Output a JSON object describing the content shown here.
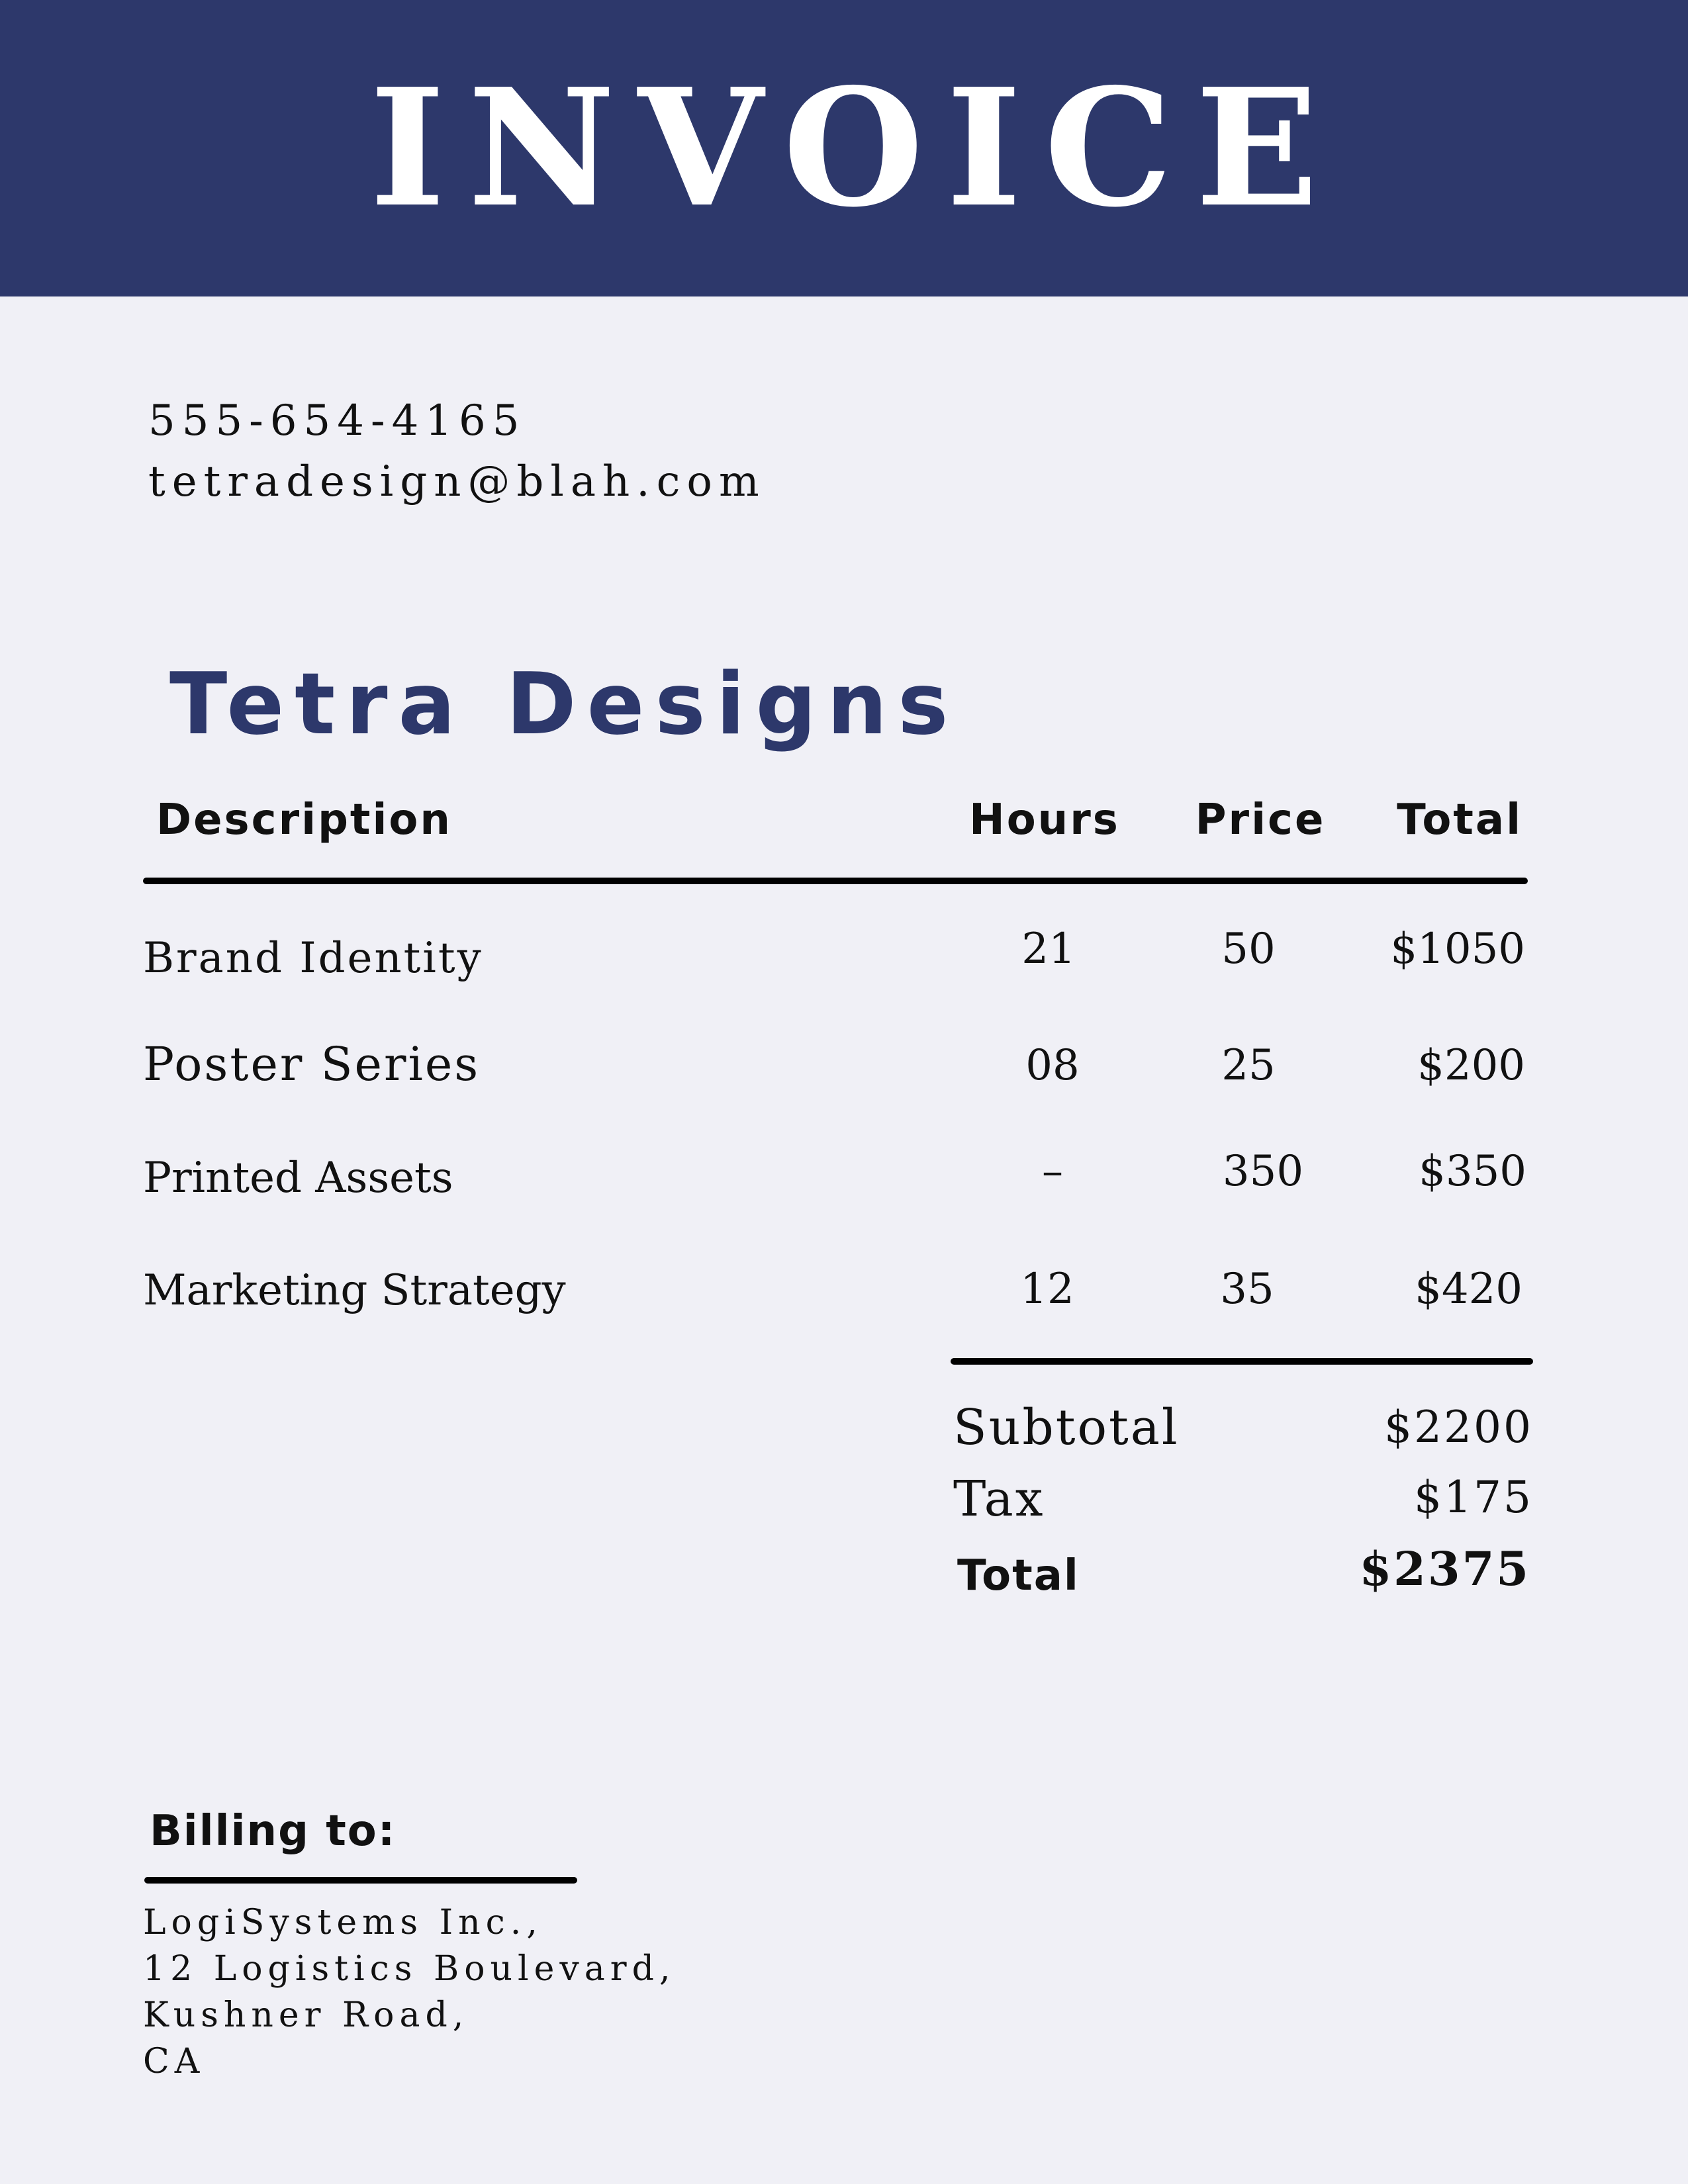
{
  "header": {
    "title": "INVOICE"
  },
  "contact": {
    "phone": "555-654-4165",
    "email": "tetradesign@blah.com"
  },
  "company": {
    "name": "Tetra Designs"
  },
  "table": {
    "columns": [
      "Description",
      "Hours",
      "Price",
      "Total"
    ],
    "rows": [
      {
        "description": "Brand Identity",
        "hours": "21",
        "price": "50",
        "total": "$1050"
      },
      {
        "description": "Poster Series",
        "hours": "08",
        "price": "25",
        "total": "$200"
      },
      {
        "description": "Printed Assets",
        "hours": "–",
        "price": "350",
        "total": "$350"
      },
      {
        "description": "Marketing Strategy",
        "hours": "12",
        "price": "35",
        "total": "$420"
      }
    ]
  },
  "summary": {
    "subtotal_label": "Subtotal",
    "subtotal": "$2200",
    "tax_label": "Tax",
    "tax": "$175",
    "total_label": "Total",
    "total": "$2375"
  },
  "billing": {
    "title": "Billing to:",
    "lines": [
      "LogiSystems Inc.,",
      "12 Logistics Boulevard,",
      "Kushner Road,",
      "CA"
    ]
  },
  "colors": {
    "brand_navy": "#2d386b",
    "page_background": "#f0f0f6"
  }
}
